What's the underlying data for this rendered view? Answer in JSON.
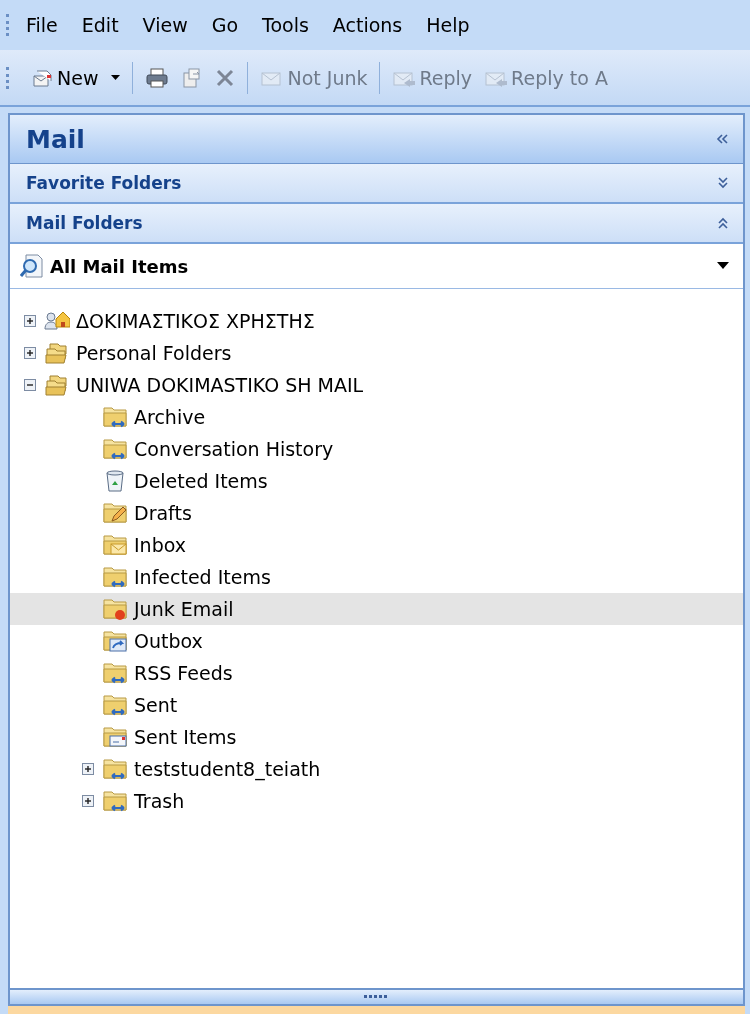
{
  "menu_bar": [
    "File",
    "Edit",
    "View",
    "Go",
    "Tools",
    "Actions",
    "Help"
  ],
  "toolbar": [
    {
      "kind": "new",
      "label": "New"
    },
    {
      "kind": "print"
    },
    {
      "kind": "move"
    },
    {
      "kind": "delete"
    },
    {
      "kind": "notjunk",
      "label": "Not Junk",
      "disabled": true
    },
    {
      "kind": "reply",
      "label": "Reply",
      "disabled": true
    },
    {
      "kind": "replyall",
      "label": "Reply to A",
      "disabled": true
    }
  ],
  "pane": {
    "title": "Mail",
    "sections": [
      {
        "label": "Favorite Folders",
        "expanded": false
      },
      {
        "label": "Mail Folders",
        "expanded": true
      }
    ],
    "view_selector": "All Mail Items",
    "tree": [
      {
        "label": "ΔΟΚΙΜΑΣΤΙΚΟΣ ΧΡΗΣΤΗΣ",
        "kind": "user",
        "expanded": false,
        "selected": false
      },
      {
        "label": "Personal Folders",
        "kind": "store",
        "expanded": false,
        "selected": false
      },
      {
        "label": "UNIWA DOKIMASTIKO SH MAIL",
        "kind": "store",
        "expanded": true,
        "selected": false,
        "children": [
          {
            "label": "Archive",
            "kind": "sync",
            "selected": false
          },
          {
            "label": "Conversation History",
            "kind": "sync",
            "selected": false
          },
          {
            "label": "Deleted Items",
            "kind": "deleted",
            "selected": false
          },
          {
            "label": "Drafts",
            "kind": "drafts",
            "selected": false
          },
          {
            "label": "Inbox",
            "kind": "inbox",
            "selected": false
          },
          {
            "label": "Infected Items",
            "kind": "sync",
            "selected": false
          },
          {
            "label": "Junk Email",
            "kind": "junk",
            "selected": true
          },
          {
            "label": "Outbox",
            "kind": "outbox",
            "selected": false
          },
          {
            "label": "RSS Feeds",
            "kind": "sync",
            "selected": false
          },
          {
            "label": "Sent",
            "kind": "sync",
            "selected": false
          },
          {
            "label": "Sent Items",
            "kind": "sent",
            "selected": false
          },
          {
            "label": "teststudent8_teiath",
            "kind": "sync",
            "expanded": false,
            "selected": false
          },
          {
            "label": "Trash",
            "kind": "sync",
            "expanded": false,
            "selected": false
          }
        ]
      }
    ]
  }
}
